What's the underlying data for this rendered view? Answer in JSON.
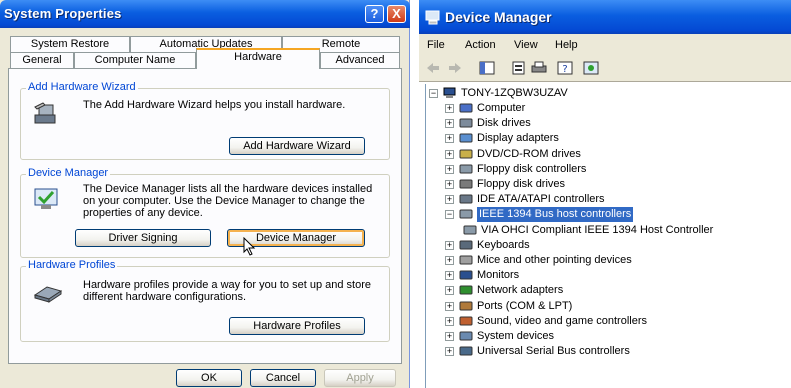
{
  "system_properties": {
    "title": "System Properties",
    "help_glyph": "?",
    "close_glyph": "X",
    "tabs_row1": [
      "System Restore",
      "Automatic Updates",
      "Remote"
    ],
    "tabs_row2": [
      "General",
      "Computer Name",
      "Hardware",
      "Advanced"
    ],
    "active_tab": "Hardware",
    "add_hardware": {
      "group_label": "Add Hardware Wizard",
      "text": "The Add Hardware Wizard helps you install hardware.",
      "button": "Add Hardware Wizard"
    },
    "device_manager": {
      "group_label": "Device Manager",
      "text_line1": "The Device Manager lists all the hardware devices installed",
      "text_line2": "on your computer. Use the Device Manager to change the",
      "text_line3": "properties of any device.",
      "driver_signing_button": "Driver Signing",
      "device_manager_button": "Device Manager"
    },
    "hardware_profiles": {
      "group_label": "Hardware Profiles",
      "text_line1": "Hardware profiles provide a way for you to set up and store",
      "text_line2": "different hardware configurations.",
      "button": "Hardware Profiles"
    },
    "footer": {
      "ok": "OK",
      "cancel": "Cancel",
      "apply": "Apply"
    }
  },
  "device_manager_window": {
    "title": "Device Manager",
    "menu": [
      "File",
      "Action",
      "View",
      "Help"
    ],
    "root": "TONY-1ZQBW3UZAV",
    "categories": [
      "Computer",
      "Disk drives",
      "Display adapters",
      "DVD/CD-ROM drives",
      "Floppy disk controllers",
      "Floppy disk drives",
      "IDE ATA/ATAPI controllers",
      "IEEE 1394 Bus host controllers",
      "VIA OHCI Compliant IEEE 1394 Host Controller",
      "Keyboards",
      "Mice and other pointing devices",
      "Monitors",
      "Network adapters",
      "Ports (COM & LPT)",
      "Sound, video and game controllers",
      "System devices",
      "Universal Serial Bus controllers"
    ],
    "selected_category": "IEEE 1394 Bus host controllers",
    "expanded_glyph": "−",
    "collapsed_glyph": "+"
  },
  "colors": {
    "title_blue": "#0a5ee0",
    "selection": "#316ac5",
    "group_label": "#0046d5"
  }
}
